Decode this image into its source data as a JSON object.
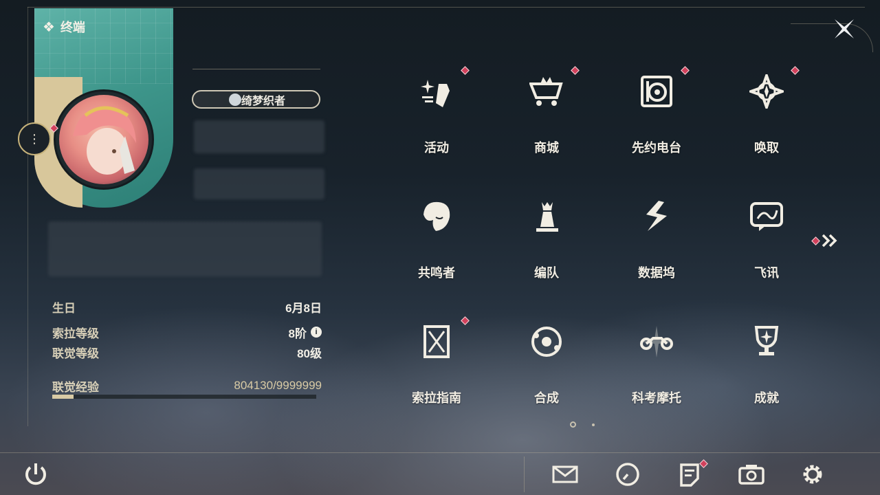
{
  "header": {
    "title": "终端"
  },
  "profile": {
    "title_badge": "绮梦织者",
    "stats": [
      {
        "key": "生日",
        "value": "6月8日"
      },
      {
        "key": "索拉等级",
        "value": "8阶"
      },
      {
        "key": "联觉等级",
        "value": "80级"
      },
      {
        "key": "联觉经验",
        "value": "804130/9999999"
      }
    ],
    "exp_progress_fraction": 0.08
  },
  "menu": {
    "items": [
      {
        "label": "活动",
        "icon": "activity-sparkle-icon",
        "badge": true
      },
      {
        "label": "商城",
        "icon": "shop-cart-icon",
        "badge": true
      },
      {
        "label": "先约电台",
        "icon": "radio-icon",
        "badge": true
      },
      {
        "label": "唤取",
        "icon": "compass-star-icon",
        "badge": true
      },
      {
        "label": "共鸣者",
        "icon": "resonator-portrait-icon",
        "badge": false
      },
      {
        "label": "编队",
        "icon": "chess-team-icon",
        "badge": false
      },
      {
        "label": "数据坞",
        "icon": "data-dock-icon",
        "badge": false
      },
      {
        "label": "飞讯",
        "icon": "message-chat-icon",
        "badge": false
      },
      {
        "label": "索拉指南",
        "icon": "guide-book-icon",
        "badge": true
      },
      {
        "label": "合成",
        "icon": "synthesis-orbit-icon",
        "badge": false
      },
      {
        "label": "科考摩托",
        "icon": "motorcycle-icon",
        "badge": false
      },
      {
        "label": "成就",
        "icon": "trophy-icon",
        "badge": false
      }
    ],
    "next_page_icon": "double-chevron-right-icon",
    "current_page": 1,
    "total_pages": 2
  },
  "bottom_bar": {
    "left_icon": "power-icon",
    "right_icons": [
      "mail-icon",
      "clock-icon",
      "notice-icon",
      "camera-icon",
      "settings-gear-icon"
    ]
  },
  "colors": {
    "accent_gold": "#d9cba5",
    "badge_red": "#d2415c",
    "portrait_teal": "#3e968b",
    "text_light": "#f1ede3"
  }
}
